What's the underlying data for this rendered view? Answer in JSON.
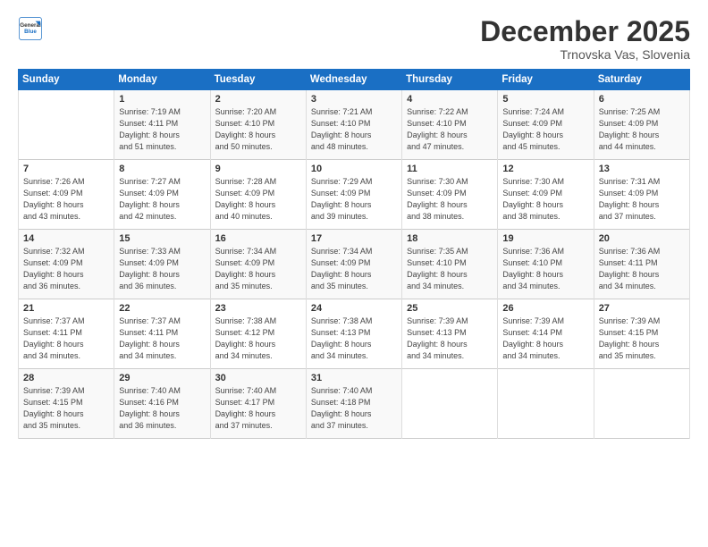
{
  "header": {
    "logo_line1": "General",
    "logo_line2": "Blue",
    "month": "December 2025",
    "location": "Trnovska Vas, Slovenia"
  },
  "days_of_week": [
    "Sunday",
    "Monday",
    "Tuesday",
    "Wednesday",
    "Thursday",
    "Friday",
    "Saturday"
  ],
  "weeks": [
    [
      {
        "day": "",
        "content": ""
      },
      {
        "day": "1",
        "content": "Sunrise: 7:19 AM\nSunset: 4:11 PM\nDaylight: 8 hours\nand 51 minutes."
      },
      {
        "day": "2",
        "content": "Sunrise: 7:20 AM\nSunset: 4:10 PM\nDaylight: 8 hours\nand 50 minutes."
      },
      {
        "day": "3",
        "content": "Sunrise: 7:21 AM\nSunset: 4:10 PM\nDaylight: 8 hours\nand 48 minutes."
      },
      {
        "day": "4",
        "content": "Sunrise: 7:22 AM\nSunset: 4:10 PM\nDaylight: 8 hours\nand 47 minutes."
      },
      {
        "day": "5",
        "content": "Sunrise: 7:24 AM\nSunset: 4:09 PM\nDaylight: 8 hours\nand 45 minutes."
      },
      {
        "day": "6",
        "content": "Sunrise: 7:25 AM\nSunset: 4:09 PM\nDaylight: 8 hours\nand 44 minutes."
      }
    ],
    [
      {
        "day": "7",
        "content": "Sunrise: 7:26 AM\nSunset: 4:09 PM\nDaylight: 8 hours\nand 43 minutes."
      },
      {
        "day": "8",
        "content": "Sunrise: 7:27 AM\nSunset: 4:09 PM\nDaylight: 8 hours\nand 42 minutes."
      },
      {
        "day": "9",
        "content": "Sunrise: 7:28 AM\nSunset: 4:09 PM\nDaylight: 8 hours\nand 40 minutes."
      },
      {
        "day": "10",
        "content": "Sunrise: 7:29 AM\nSunset: 4:09 PM\nDaylight: 8 hours\nand 39 minutes."
      },
      {
        "day": "11",
        "content": "Sunrise: 7:30 AM\nSunset: 4:09 PM\nDaylight: 8 hours\nand 38 minutes."
      },
      {
        "day": "12",
        "content": "Sunrise: 7:30 AM\nSunset: 4:09 PM\nDaylight: 8 hours\nand 38 minutes."
      },
      {
        "day": "13",
        "content": "Sunrise: 7:31 AM\nSunset: 4:09 PM\nDaylight: 8 hours\nand 37 minutes."
      }
    ],
    [
      {
        "day": "14",
        "content": "Sunrise: 7:32 AM\nSunset: 4:09 PM\nDaylight: 8 hours\nand 36 minutes."
      },
      {
        "day": "15",
        "content": "Sunrise: 7:33 AM\nSunset: 4:09 PM\nDaylight: 8 hours\nand 36 minutes."
      },
      {
        "day": "16",
        "content": "Sunrise: 7:34 AM\nSunset: 4:09 PM\nDaylight: 8 hours\nand 35 minutes."
      },
      {
        "day": "17",
        "content": "Sunrise: 7:34 AM\nSunset: 4:09 PM\nDaylight: 8 hours\nand 35 minutes."
      },
      {
        "day": "18",
        "content": "Sunrise: 7:35 AM\nSunset: 4:10 PM\nDaylight: 8 hours\nand 34 minutes."
      },
      {
        "day": "19",
        "content": "Sunrise: 7:36 AM\nSunset: 4:10 PM\nDaylight: 8 hours\nand 34 minutes."
      },
      {
        "day": "20",
        "content": "Sunrise: 7:36 AM\nSunset: 4:11 PM\nDaylight: 8 hours\nand 34 minutes."
      }
    ],
    [
      {
        "day": "21",
        "content": "Sunrise: 7:37 AM\nSunset: 4:11 PM\nDaylight: 8 hours\nand 34 minutes."
      },
      {
        "day": "22",
        "content": "Sunrise: 7:37 AM\nSunset: 4:11 PM\nDaylight: 8 hours\nand 34 minutes."
      },
      {
        "day": "23",
        "content": "Sunrise: 7:38 AM\nSunset: 4:12 PM\nDaylight: 8 hours\nand 34 minutes."
      },
      {
        "day": "24",
        "content": "Sunrise: 7:38 AM\nSunset: 4:13 PM\nDaylight: 8 hours\nand 34 minutes."
      },
      {
        "day": "25",
        "content": "Sunrise: 7:39 AM\nSunset: 4:13 PM\nDaylight: 8 hours\nand 34 minutes."
      },
      {
        "day": "26",
        "content": "Sunrise: 7:39 AM\nSunset: 4:14 PM\nDaylight: 8 hours\nand 34 minutes."
      },
      {
        "day": "27",
        "content": "Sunrise: 7:39 AM\nSunset: 4:15 PM\nDaylight: 8 hours\nand 35 minutes."
      }
    ],
    [
      {
        "day": "28",
        "content": "Sunrise: 7:39 AM\nSunset: 4:15 PM\nDaylight: 8 hours\nand 35 minutes."
      },
      {
        "day": "29",
        "content": "Sunrise: 7:40 AM\nSunset: 4:16 PM\nDaylight: 8 hours\nand 36 minutes."
      },
      {
        "day": "30",
        "content": "Sunrise: 7:40 AM\nSunset: 4:17 PM\nDaylight: 8 hours\nand 37 minutes."
      },
      {
        "day": "31",
        "content": "Sunrise: 7:40 AM\nSunset: 4:18 PM\nDaylight: 8 hours\nand 37 minutes."
      },
      {
        "day": "",
        "content": ""
      },
      {
        "day": "",
        "content": ""
      },
      {
        "day": "",
        "content": ""
      }
    ]
  ]
}
